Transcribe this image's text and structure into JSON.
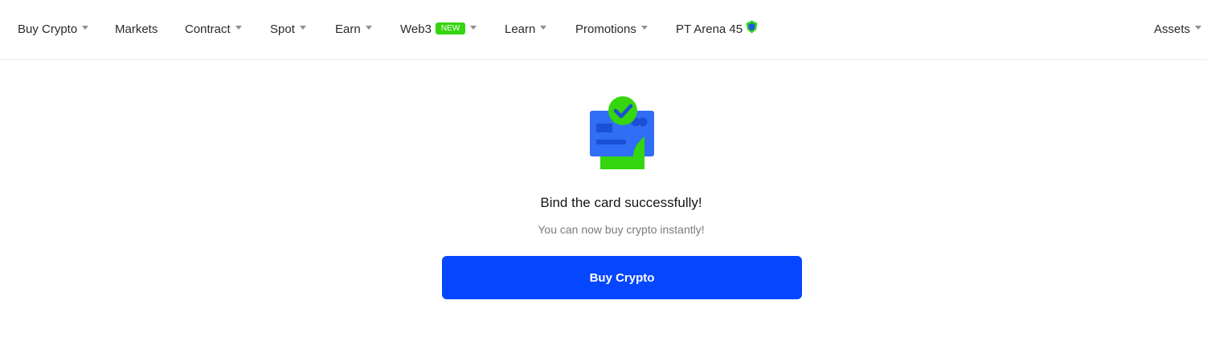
{
  "nav": {
    "buy_crypto": "Buy Crypto",
    "markets": "Markets",
    "contract": "Contract",
    "spot": "Spot",
    "earn": "Earn",
    "web3": "Web3",
    "web3_badge": "NEW",
    "learn": "Learn",
    "promotions": "Promotions",
    "pt_arena": "PT Arena 45",
    "assets": "Assets"
  },
  "success": {
    "title": "Bind the card successfully!",
    "subtitle": "You can now buy crypto instantly!",
    "button_label": "Buy Crypto",
    "icon": "card-check-icon"
  },
  "colors": {
    "accent_blue": "#0546ff",
    "card_blue": "#2f6ef5",
    "success_green": "#35d50f",
    "badge_green": "#35d50f"
  }
}
